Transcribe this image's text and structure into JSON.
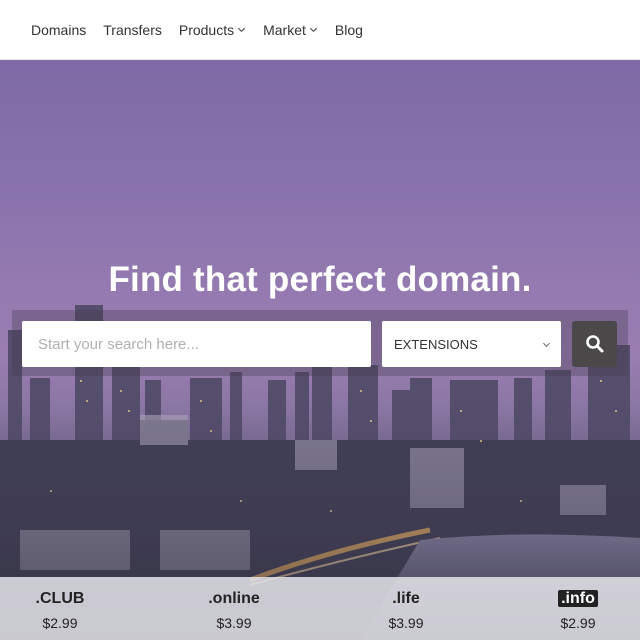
{
  "nav": {
    "items": [
      {
        "label": "Domains",
        "dropdown": false
      },
      {
        "label": "Transfers",
        "dropdown": false
      },
      {
        "label": "Products",
        "dropdown": true
      },
      {
        "label": "Market",
        "dropdown": true
      },
      {
        "label": "Blog",
        "dropdown": false
      }
    ]
  },
  "hero": {
    "headline": "Find that perfect domain.",
    "search_placeholder": "Start your search here...",
    "extensions_label": "EXTENSIONS",
    "search_icon": "search-icon"
  },
  "tlds": [
    {
      "name": ".CLUB",
      "price": "$2.99"
    },
    {
      "name": ".online",
      "price": "$3.99"
    },
    {
      "name": ".life",
      "price": "$3.99"
    },
    {
      "name": ".info",
      "price": "$2.99"
    }
  ],
  "colors": {
    "nav_bg": "#ffffff",
    "search_button": "#4a4848",
    "hero_top": "#7e6aa6"
  }
}
